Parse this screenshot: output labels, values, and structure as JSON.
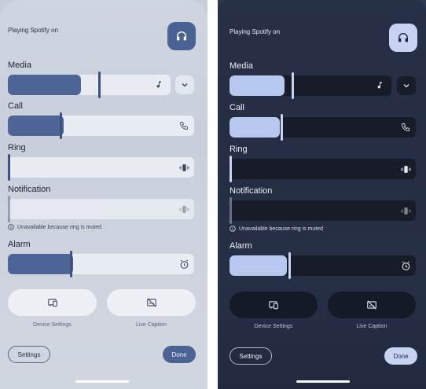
{
  "colors": {
    "light_accent": "#4d6596",
    "dark_accent": "#b7c8ee",
    "dark_track": "#171c28",
    "light_track": "#e9ecf3"
  },
  "panels": [
    {
      "theme": "light",
      "header": {
        "playing_text": "Playing Spotify on",
        "output_icon": "headphones-icon"
      },
      "sliders": {
        "media": {
          "label": "Media",
          "level": 0.45,
          "icon": "music-note-icon",
          "expand_icon": "chevron-down-icon"
        },
        "call": {
          "label": "Call",
          "level": 0.3,
          "icon": "phone-icon"
        },
        "ring": {
          "label": "Ring",
          "level": 0.0,
          "icon": "vibrate-icon"
        },
        "notification": {
          "label": "Notification",
          "level": 0.0,
          "icon": "vibrate-icon",
          "hint": "Unavailable because ring is muted",
          "hint_icon": "info-icon"
        },
        "alarm": {
          "label": "Alarm",
          "level": 0.35,
          "icon": "alarm-clock-icon"
        }
      },
      "quick": [
        {
          "label": "Device Settings",
          "icon": "device-settings-icon"
        },
        {
          "label": "Live Caption",
          "icon": "live-caption-off-icon"
        }
      ],
      "footer": {
        "settings_label": "Settings",
        "done_label": "Done"
      }
    },
    {
      "theme": "dark",
      "header": {
        "playing_text": "Playing Spotify on",
        "output_icon": "headphones-icon"
      },
      "sliders": {
        "media": {
          "label": "Media",
          "level": 0.34,
          "icon": "music-note-icon",
          "expand_icon": "chevron-down-icon"
        },
        "call": {
          "label": "Call",
          "level": 0.27,
          "icon": "phone-icon"
        },
        "ring": {
          "label": "Ring",
          "level": 0.0,
          "icon": "vibrate-icon"
        },
        "notification": {
          "label": "Notification",
          "level": 0.0,
          "icon": "vibrate-icon",
          "hint": "Unavailable because ring is muted",
          "hint_icon": "info-icon"
        },
        "alarm": {
          "label": "Alarm",
          "level": 0.31,
          "icon": "alarm-clock-icon"
        }
      },
      "quick": [
        {
          "label": "Device Settings",
          "icon": "device-settings-icon"
        },
        {
          "label": "Live Caption",
          "icon": "live-caption-off-icon"
        }
      ],
      "footer": {
        "settings_label": "Settings",
        "done_label": "Done"
      }
    }
  ]
}
